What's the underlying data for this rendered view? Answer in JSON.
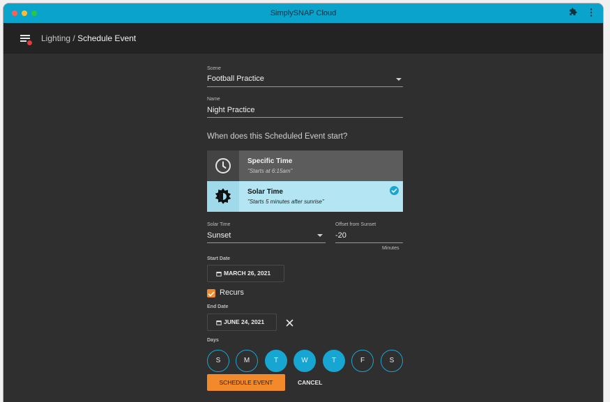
{
  "window": {
    "title": "SimplySNAP Cloud",
    "traffic_lights": [
      "#ff5f57",
      "#febc2e",
      "#28c840"
    ],
    "titlebar_color": "#0aa3cc",
    "extensions_icon": "puzzle-icon",
    "more_icon": "more-vert-icon"
  },
  "appbar": {
    "menu_icon": "menu-icon",
    "breadcrumb_parent": "Lighting",
    "breadcrumb_separator": " / ",
    "breadcrumb_current": "Schedule Event"
  },
  "form": {
    "scene": {
      "label": "Scene",
      "value": "Football Practice"
    },
    "name": {
      "label": "Name",
      "value": "Night Practice"
    },
    "question": "When does this Scheduled Event start?",
    "options": [
      {
        "title": "Specific Time",
        "subtitle": "\"Starts at 6:15am\"",
        "icon": "clock-icon",
        "selected": false
      },
      {
        "title": "Solar Time",
        "subtitle": "\"Starts 5 minutes after sunrise\"",
        "icon": "sun-icon",
        "selected": true
      }
    ],
    "solar_time": {
      "label": "Solar Time",
      "value": "Sunset"
    },
    "offset": {
      "label": "Offset from Sunset",
      "value": "-20",
      "unit": "Minutes"
    },
    "start_date": {
      "label": "Start Date",
      "value": "MARCH 26, 2021"
    },
    "recurs": {
      "label": "Recurs",
      "checked": true
    },
    "end_date": {
      "label": "End Date",
      "value": "JUNE 24, 2021"
    },
    "days": {
      "label": "Days",
      "items": [
        {
          "label": "S",
          "on": false
        },
        {
          "label": "M",
          "on": false
        },
        {
          "label": "T",
          "on": true
        },
        {
          "label": "W",
          "on": true
        },
        {
          "label": "T",
          "on": true
        },
        {
          "label": "F",
          "on": false
        },
        {
          "label": "S",
          "on": false
        }
      ]
    },
    "submit_label": "SCHEDULE EVENT",
    "cancel_label": "CANCEL"
  },
  "colors": {
    "accent_blue": "#17a6d1",
    "accent_orange": "#f28a2b",
    "selected_option_bg": "#b3e6f2",
    "unselected_option_bg": "#5c5c5c",
    "background": "#2f2f2f"
  }
}
